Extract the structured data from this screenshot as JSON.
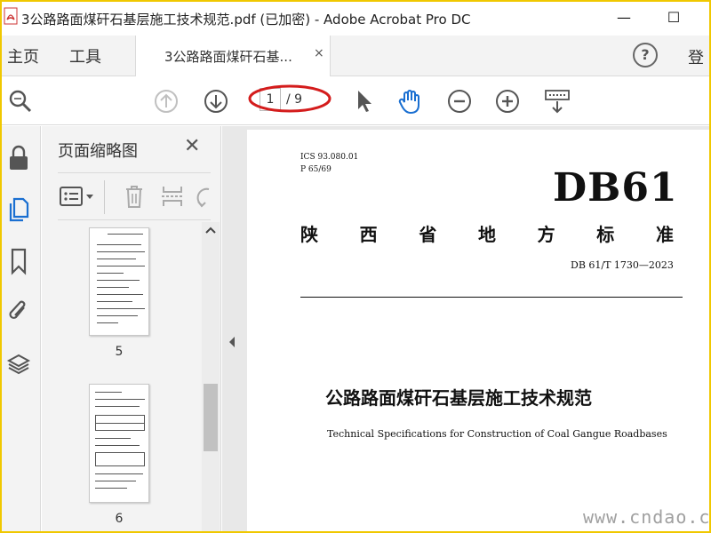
{
  "window": {
    "title": "3公路路面煤矸石基层施工技术规范.pdf (已加密) - Adobe Acrobat Pro DC",
    "minimize": "—",
    "maximize": "☐"
  },
  "tabs": {
    "home": "主页",
    "tools": "工具",
    "document": "3公路路面煤矸石基...",
    "close": "×"
  },
  "help": "?",
  "signin": "登",
  "toolbar": {
    "page_current": "1",
    "page_total": "/ 9"
  },
  "panel": {
    "title": "页面缩略图",
    "close": "✕",
    "thumbnails": [
      {
        "number": "5"
      },
      {
        "number": "6"
      }
    ]
  },
  "document": {
    "ics": "ICS 93.080.01",
    "class_no": "P 65/69",
    "code_big": "DB61",
    "province_chars": [
      "陕",
      "西",
      "省",
      "地",
      "方",
      "标",
      "准"
    ],
    "standard_no": "DB 61/T 1730—2023",
    "title_cn": "公路路面煤矸石基层施工技术规范",
    "title_en": "Technical Specifications for Construction of Coal Gangue Roadbases"
  },
  "watermark": "www.cndao.com",
  "colors": {
    "frame": "#f0c800",
    "accent_blue": "#1a6fd1",
    "annotation_red": "#d41c1c"
  }
}
